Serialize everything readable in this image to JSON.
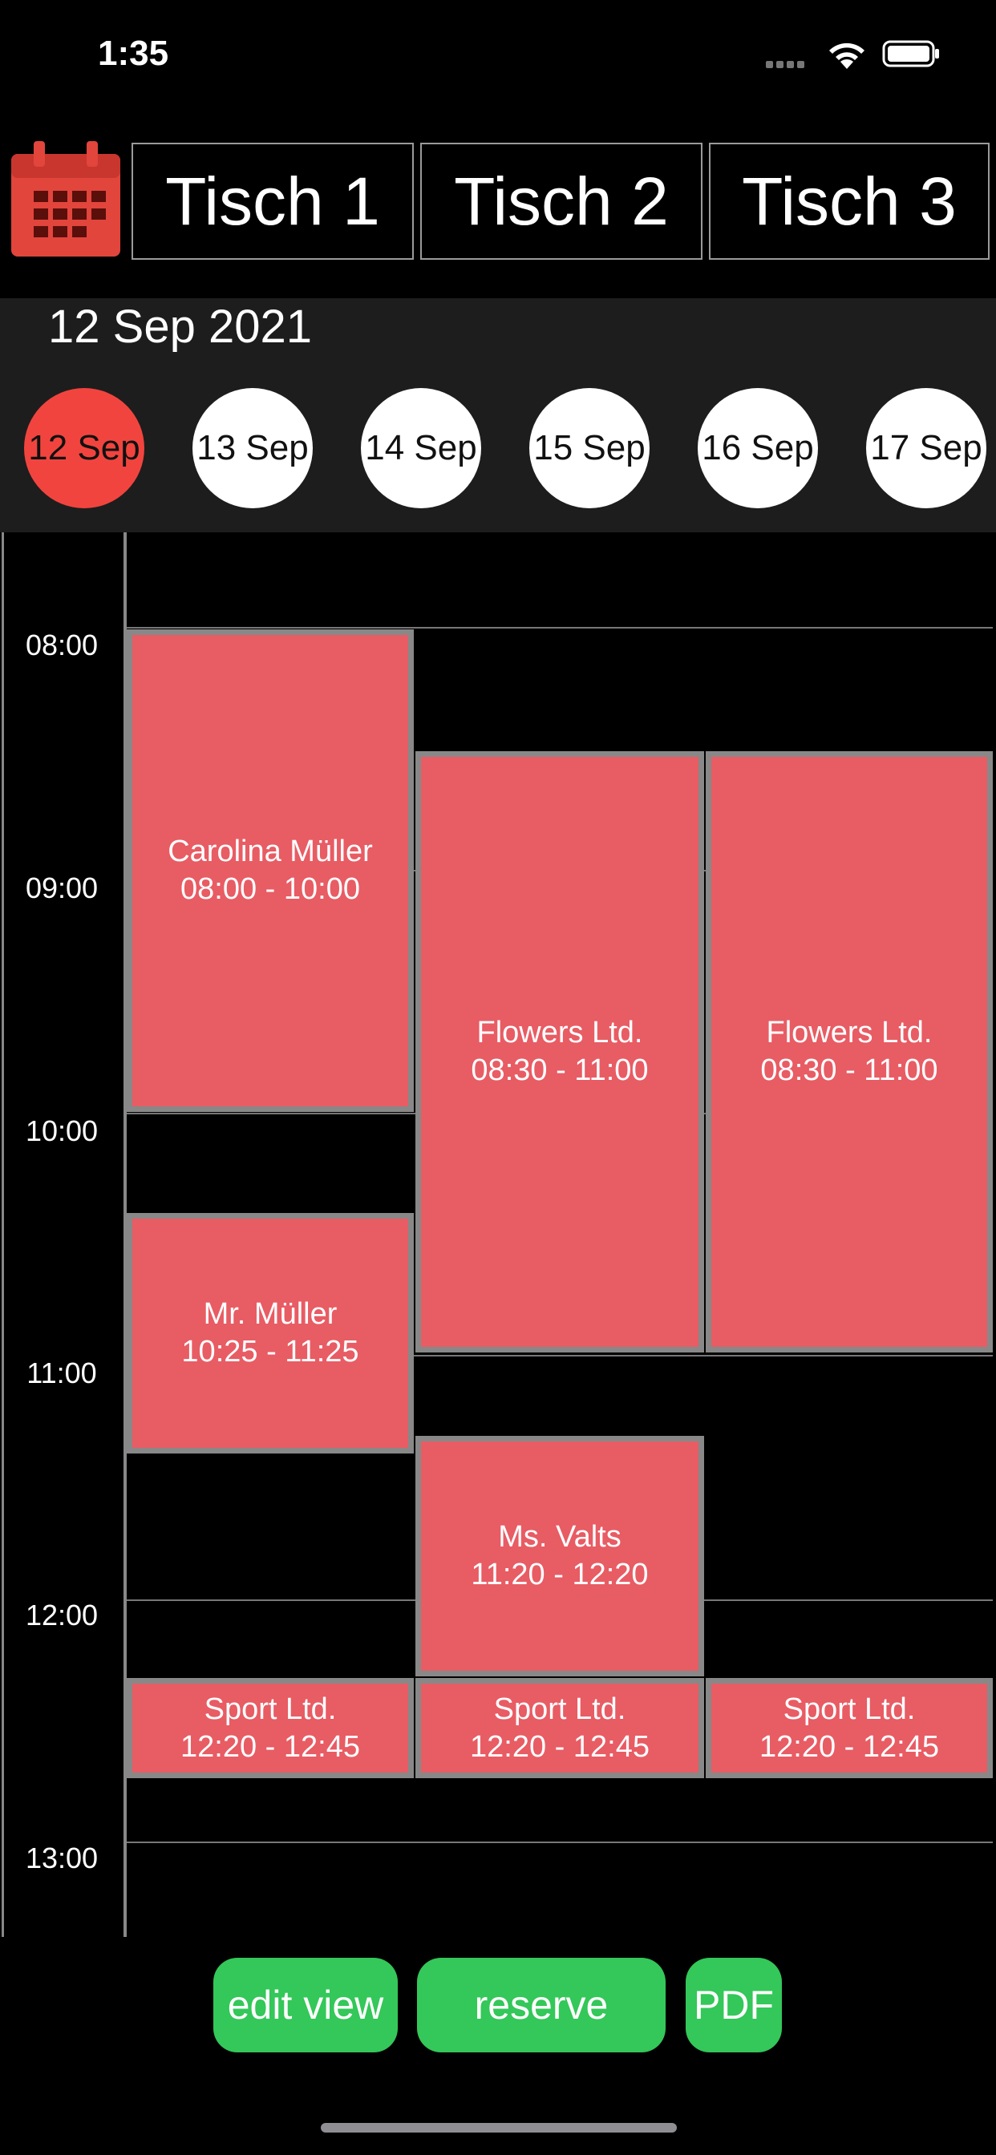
{
  "status_bar": {
    "time": "1:35"
  },
  "header": {
    "calendar_icon": "calendar-icon",
    "tables": [
      "Tisch 1",
      "Tisch 2",
      "Tisch 3"
    ]
  },
  "date_picker": {
    "current_date": "12 Sep 2021",
    "days": [
      "12 Sep",
      "13 Sep",
      "14 Sep",
      "15 Sep",
      "16 Sep",
      "17 Sep"
    ],
    "selected_index": 0
  },
  "schedule": {
    "time_labels": [
      "08:00",
      "09:00",
      "10:00",
      "11:00",
      "12:00",
      "13:00"
    ],
    "appointments": [
      {
        "table": "Tisch 1",
        "name": "Carolina Müller",
        "time": "08:00 - 10:00"
      },
      {
        "table": "Tisch 2",
        "name": "Flowers Ltd.",
        "time": "08:30 - 11:00"
      },
      {
        "table": "Tisch 3",
        "name": "Flowers Ltd.",
        "time": "08:30 - 11:00"
      },
      {
        "table": "Tisch 1",
        "name": "Mr. Müller",
        "time": "10:25 - 11:25"
      },
      {
        "table": "Tisch 2",
        "name": "Ms. Valts",
        "time": "11:20 - 12:20"
      },
      {
        "table": "Tisch 1",
        "name": "Sport Ltd.",
        "time": "12:20 - 12:45"
      },
      {
        "table": "Tisch 2",
        "name": "Sport Ltd.",
        "time": "12:20 - 12:45"
      },
      {
        "table": "Tisch 3",
        "name": "Sport Ltd.",
        "time": "12:20 - 12:45"
      }
    ]
  },
  "actions": {
    "edit_view": "edit view",
    "reserve": "reserve",
    "pdf": "PDF"
  },
  "colors": {
    "accent": "#34c759",
    "appointment": "#e85c64",
    "selected_day": "#f2443e"
  }
}
